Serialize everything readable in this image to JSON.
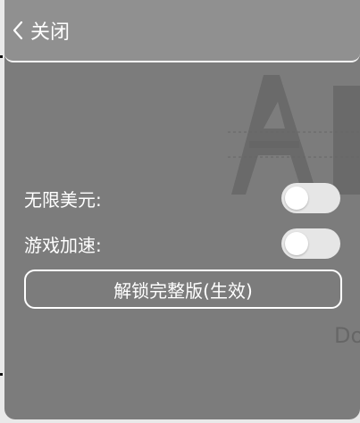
{
  "header": {
    "close_label": "关闭",
    "back_icon": "chevron-left-icon"
  },
  "settings": {
    "rows": [
      {
        "label": "无限美元:",
        "enabled": false
      },
      {
        "label": "游戏加速:",
        "enabled": false
      }
    ],
    "unlock_label": "解锁完整版(生效)"
  },
  "background": {
    "logo_letters": "AE",
    "text": "Do"
  },
  "colors": {
    "panel": "#707070",
    "header": "#929292",
    "toggle_track": "#e6e6e6",
    "toggle_knob": "#ffffff",
    "text": "#ffffff"
  }
}
